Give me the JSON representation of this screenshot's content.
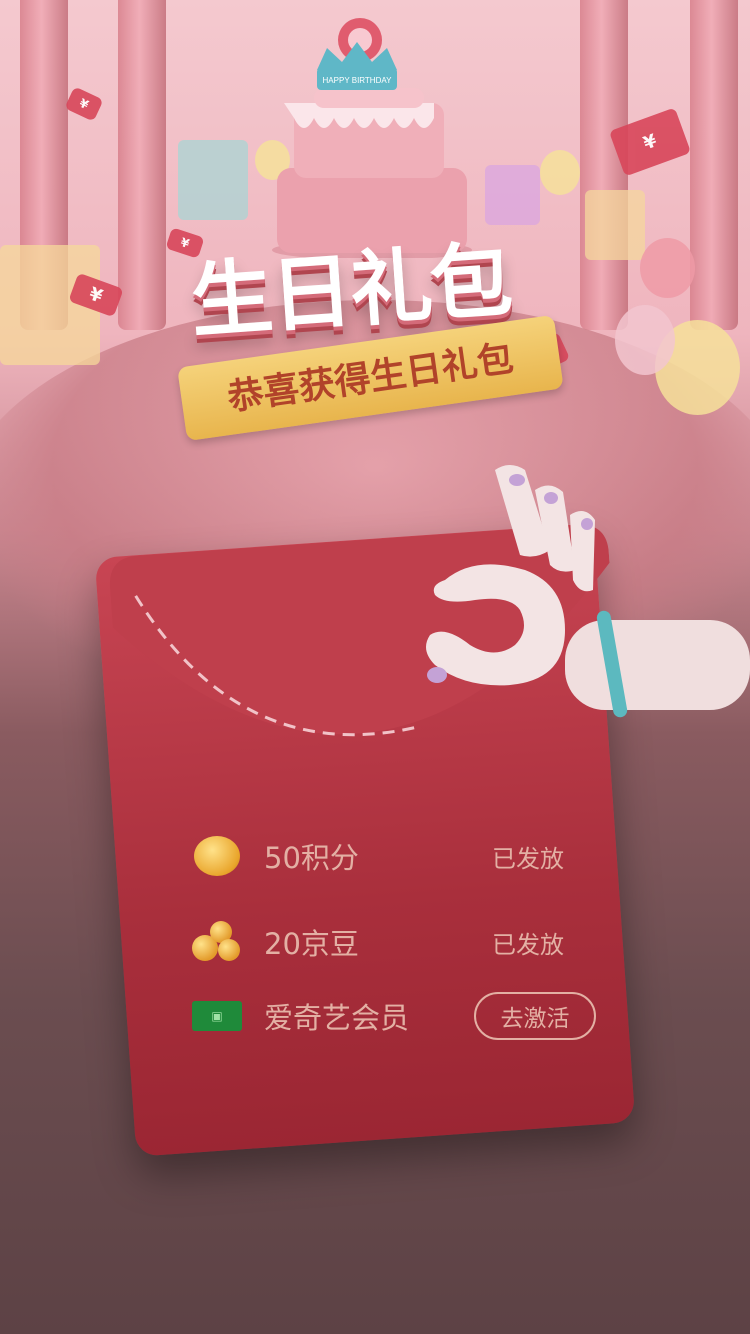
{
  "banner": {
    "title": "生日礼包",
    "subtitle": "恭喜获得生日礼包",
    "cake_topper": "HAPPY BIRTHDAY",
    "coupon_symbol": "¥"
  },
  "gift_items": [
    {
      "icon": "coin-icon",
      "label": "50积分",
      "status": "已发放"
    },
    {
      "icon": "jingdou-icon",
      "label": "20京豆",
      "status": "已发放"
    },
    {
      "icon": "iqiyi-icon",
      "label": "爱奇艺会员",
      "action": "去激活"
    }
  ],
  "colors": {
    "envelope": "#b23643",
    "text_muted": "#e3b0a4",
    "ribbon": "#f0c65e",
    "title_shadow": "#d46b79"
  }
}
